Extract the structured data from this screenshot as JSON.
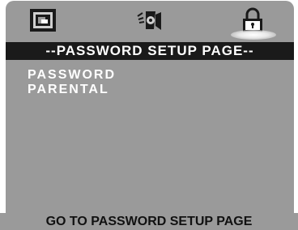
{
  "header": {
    "tabs": [
      {
        "icon": "general-setup-icon",
        "selected": false
      },
      {
        "icon": "audio-setup-icon",
        "selected": false
      },
      {
        "icon": "padlock-icon",
        "selected": true
      }
    ],
    "page_title": "--PASSWORD SETUP PAGE--"
  },
  "menu": {
    "items": [
      {
        "label": "PASSWORD"
      },
      {
        "label": "PARENTAL"
      }
    ]
  },
  "status_bar": {
    "text": "GO TO PASSWORD SETUP PAGE"
  },
  "colors": {
    "panel": "#9a9a9a",
    "title_bar": "#1a1a1a",
    "menu_text": "#ffffff",
    "status_text": "#111111"
  }
}
